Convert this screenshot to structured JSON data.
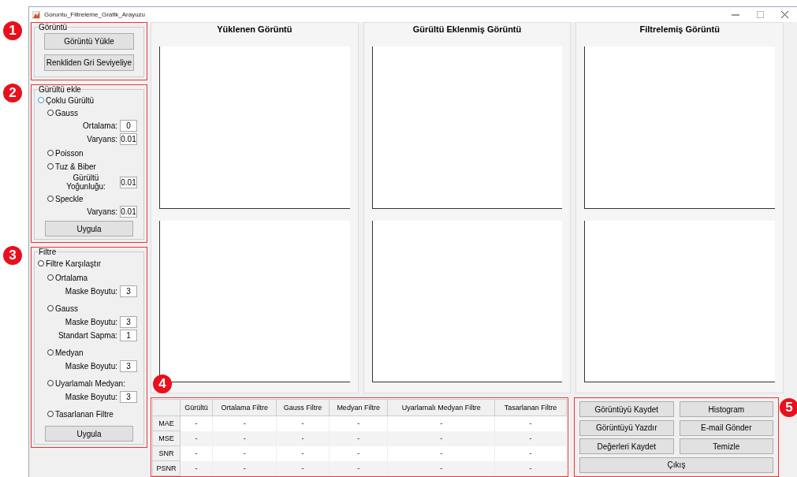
{
  "window": {
    "title": "Goruntu_Filtreleme_Grafik_Arayuzu"
  },
  "image_group": {
    "badge": "1",
    "title": "Görüntü",
    "buttons": [
      "Görüntü Yükle",
      "Renkliden Gri Seviyeliye"
    ]
  },
  "noise_group": {
    "badge": "2",
    "title": "Gürültü ekle",
    "options": [
      {
        "label": "Çoklu Gürültü",
        "selected": false,
        "focused": true,
        "children": [
          {
            "label": "Gauss",
            "selected": false,
            "focused": false,
            "fields": [
              {
                "label": "Ortalama:",
                "value": "0"
              },
              {
                "label": "Varyans:",
                "value": "0.01"
              }
            ]
          },
          {
            "label": "Poisson",
            "selected": false,
            "focused": false
          },
          {
            "label": "Tuz & Biber",
            "selected": false,
            "focused": false,
            "fields": [
              {
                "label": "Gürültü Yoğunluğu:",
                "value": "0.01"
              }
            ]
          },
          {
            "label": "Speckle",
            "selected": false,
            "focused": false,
            "fields": [
              {
                "label": "Varyans:",
                "value": "0.01"
              }
            ]
          }
        ]
      }
    ],
    "apply": "Uygula"
  },
  "filter_group": {
    "badge": "3",
    "title": "Filtre",
    "options": [
      {
        "label": "Filtre Karşılaştır",
        "selected": false,
        "focused": false,
        "children": [
          {
            "label": "Ortalama",
            "selected": false,
            "focused": false,
            "fields": [
              {
                "label": "Maske Boyutu:",
                "value": "3"
              }
            ]
          },
          {
            "label": "Gauss",
            "selected": false,
            "focused": false,
            "fields": [
              {
                "label": "Maske Boyutu:",
                "value": "3"
              },
              {
                "label": "Standart Sapma:",
                "value": "1"
              }
            ]
          },
          {
            "label": "Medyan",
            "selected": false,
            "focused": false,
            "fields": [
              {
                "label": "Maske Boyutu:",
                "value": "3"
              }
            ]
          },
          {
            "label": "Uyarlamalı Medyan:",
            "selected": false,
            "focused": false,
            "fields": [
              {
                "label": "Maske Boyutu:",
                "value": "3"
              }
            ]
          },
          {
            "label": "Tasarlanan Filtre",
            "selected": false,
            "focused": false
          }
        ]
      }
    ],
    "apply": "Uygula"
  },
  "image_panels": [
    {
      "title": "Yüklenen Görüntü"
    },
    {
      "title": "Gürültü Eklenmiş Görüntü"
    },
    {
      "title": "Filtrelemiş Görüntü"
    }
  ],
  "table": {
    "badge": "4",
    "columns": [
      "Gürültü",
      "Ortalama Filtre",
      "Gauss Filtre",
      "Medyan Filtre",
      "Uyarlamalı Medyan Filtre",
      "Tasarlanan Filtre"
    ],
    "rows": [
      {
        "name": "MAE",
        "cells": [
          "-",
          "-",
          "-",
          "-",
          "-",
          "-"
        ]
      },
      {
        "name": "MSE",
        "cells": [
          "-",
          "-",
          "-",
          "-",
          "-",
          "-"
        ]
      },
      {
        "name": "SNR",
        "cells": [
          "-",
          "-",
          "-",
          "-",
          "-",
          "-"
        ]
      },
      {
        "name": "PSNR",
        "cells": [
          "-",
          "-",
          "-",
          "-",
          "-",
          "-"
        ]
      }
    ]
  },
  "actions": {
    "badge": "5",
    "buttons": [
      "Görüntüyü Kaydet",
      "Histogram",
      "Görüntüyü Yazdır",
      "E-mail Gönder",
      "Değerleri Kaydet",
      "Temizle"
    ],
    "wide_button": "Çıkış"
  }
}
